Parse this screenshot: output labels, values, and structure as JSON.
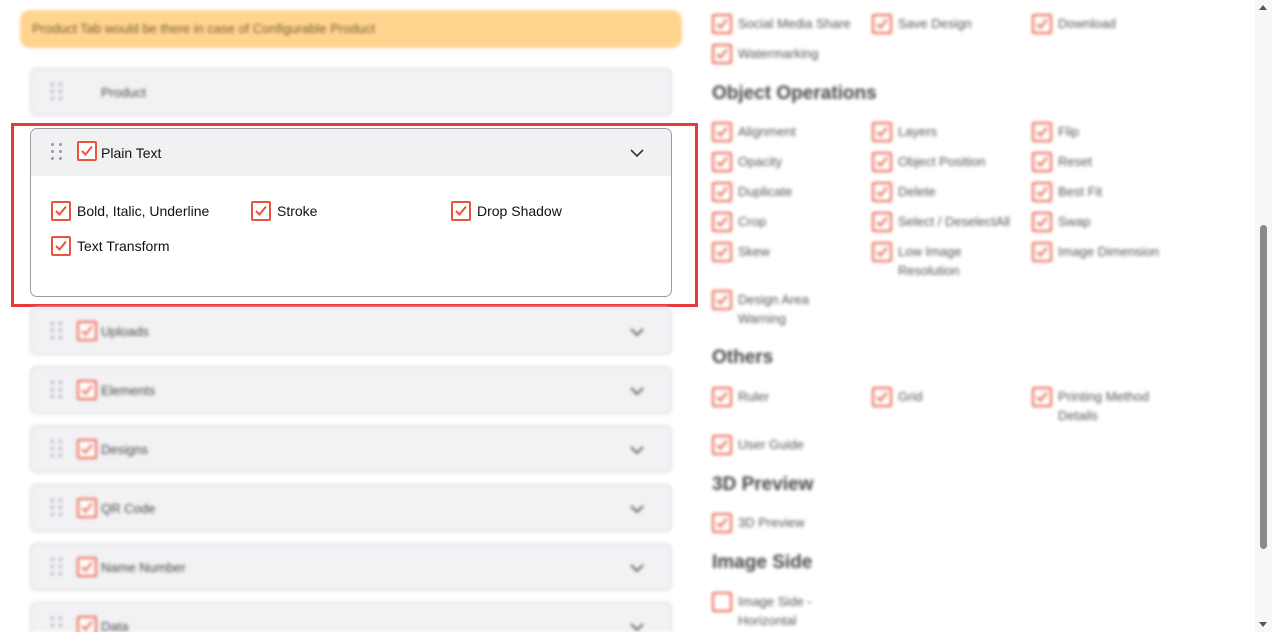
{
  "notice": "Product Tab would be there in case of Configurable Product",
  "accordions_top": [
    {
      "label": "Product",
      "checkbox": false
    }
  ],
  "expanded": {
    "label": "Plain Text",
    "options": [
      "Bold, Italic, Underline",
      "Stroke",
      "Drop Shadow",
      "Text Transform"
    ]
  },
  "accordions_bottom": [
    {
      "label": "Uploads"
    },
    {
      "label": "Elements"
    },
    {
      "label": "Designs"
    },
    {
      "label": "QR Code"
    },
    {
      "label": "Name Number"
    },
    {
      "label": "Data"
    }
  ],
  "right": {
    "top_items": [
      "Social Media Share",
      "Save Design",
      "Download",
      "Watermarking"
    ],
    "sections": [
      {
        "title": "Object Operations",
        "items": [
          "Alignment",
          "Layers",
          "Flip",
          "Opacity",
          "Object Position",
          "Reset",
          "Duplicate",
          "Delete",
          "Best Fit",
          "Crop",
          "Select / DeselectAll",
          "Swap",
          "Skew",
          "Low Image Resolution",
          "Image Dimension",
          "Design Area Warning"
        ]
      },
      {
        "title": "Others",
        "items": [
          "Ruler",
          "Grid",
          "Printing Method Details",
          "User Guide"
        ]
      },
      {
        "title": "3D Preview",
        "items": [
          "3D Preview"
        ]
      },
      {
        "title": "Image Side",
        "items": [
          "Image Side - Horizontal"
        ]
      }
    ]
  },
  "colors": {
    "accent": "#e8553c",
    "highlight": "#e83a3a",
    "notice_bg": "#ffd083"
  }
}
